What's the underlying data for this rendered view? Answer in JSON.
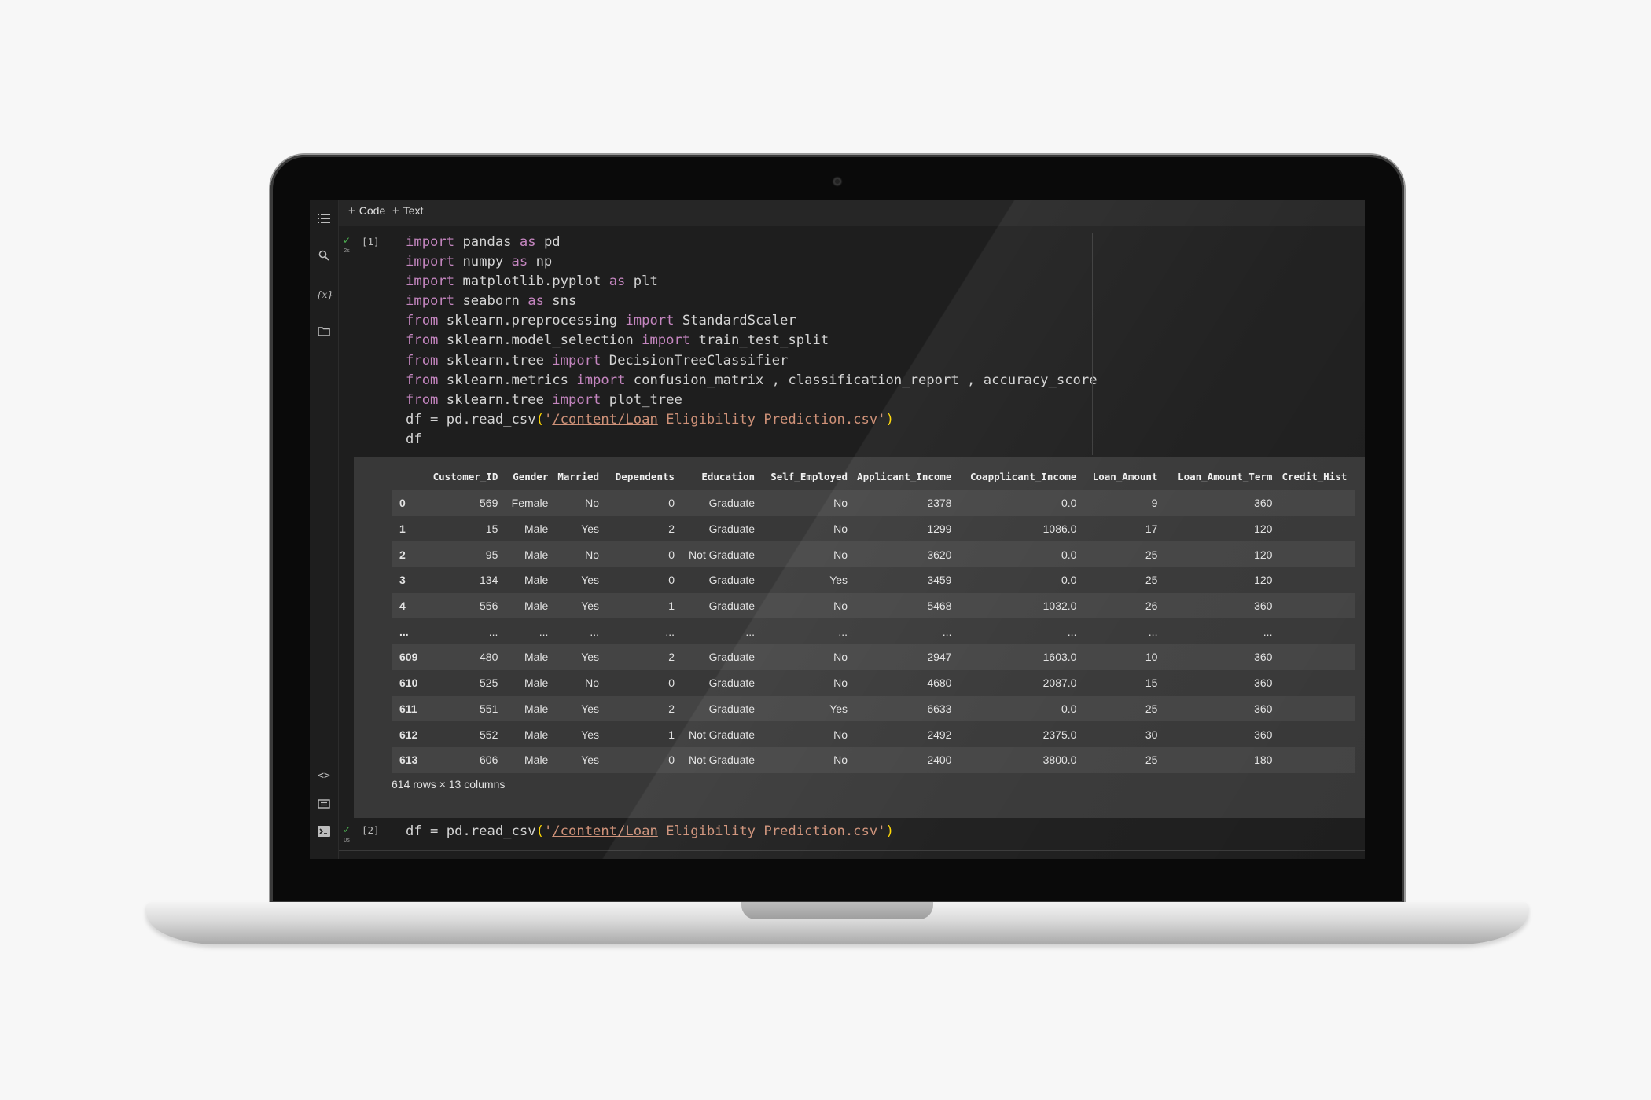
{
  "toolbar": {
    "add_code_label": "Code",
    "add_text_label": "Text"
  },
  "cell1": {
    "exec_count": "[1]",
    "run_time": "2s",
    "code_lines": [
      [
        {
          "t": "import",
          "c": "kw"
        },
        {
          "t": " pandas "
        },
        {
          "t": "as",
          "c": "kw"
        },
        {
          "t": " pd"
        }
      ],
      [
        {
          "t": "import",
          "c": "kw"
        },
        {
          "t": " numpy "
        },
        {
          "t": "as",
          "c": "kw"
        },
        {
          "t": " np"
        }
      ],
      [
        {
          "t": "import",
          "c": "kw"
        },
        {
          "t": " matplotlib.pyplot "
        },
        {
          "t": "as",
          "c": "kw"
        },
        {
          "t": " plt"
        }
      ],
      [
        {
          "t": "import",
          "c": "kw"
        },
        {
          "t": " seaborn "
        },
        {
          "t": "as",
          "c": "kw"
        },
        {
          "t": " sns"
        }
      ],
      [
        {
          "t": "from",
          "c": "kw"
        },
        {
          "t": " sklearn.preprocessing "
        },
        {
          "t": "import",
          "c": "kw"
        },
        {
          "t": " StandardScaler"
        }
      ],
      [
        {
          "t": "from",
          "c": "kw"
        },
        {
          "t": " sklearn.model_selection "
        },
        {
          "t": "import",
          "c": "kw"
        },
        {
          "t": " train_test_split"
        }
      ],
      [
        {
          "t": "from",
          "c": "kw"
        },
        {
          "t": " sklearn.tree "
        },
        {
          "t": "import",
          "c": "kw"
        },
        {
          "t": " DecisionTreeClassifier"
        }
      ],
      [
        {
          "t": "from",
          "c": "kw"
        },
        {
          "t": " sklearn.metrics "
        },
        {
          "t": "import",
          "c": "kw"
        },
        {
          "t": " confusion_matrix , classification_report , accuracy_score"
        }
      ],
      [
        {
          "t": "from",
          "c": "kw"
        },
        {
          "t": " sklearn.tree "
        },
        {
          "t": "import",
          "c": "kw"
        },
        {
          "t": " plot_tree"
        }
      ],
      [
        {
          "t": "df = pd.read_csv"
        },
        {
          "t": "(",
          "c": "paren"
        },
        {
          "t": "'",
          "c": "str"
        },
        {
          "t": "/content/Loan",
          "c": "str path"
        },
        {
          "t": " Eligibility Prediction.csv'",
          "c": "str"
        },
        {
          "t": ")",
          "c": "paren"
        }
      ],
      [
        {
          "t": "df"
        }
      ]
    ]
  },
  "dataframe": {
    "columns": [
      "",
      "Customer_ID",
      "Gender",
      "Married",
      "Dependents",
      "Education",
      "Self_Employed",
      "Applicant_Income",
      "Coapplicant_Income",
      "Loan_Amount",
      "Loan_Amount_Term",
      "Credit_Hist"
    ],
    "rows": [
      [
        "0",
        "569",
        "Female",
        "No",
        "0",
        "Graduate",
        "No",
        "2378",
        "0.0",
        "9",
        "360",
        ""
      ],
      [
        "1",
        "15",
        "Male",
        "Yes",
        "2",
        "Graduate",
        "No",
        "1299",
        "1086.0",
        "17",
        "120",
        ""
      ],
      [
        "2",
        "95",
        "Male",
        "No",
        "0",
        "Not Graduate",
        "No",
        "3620",
        "0.0",
        "25",
        "120",
        ""
      ],
      [
        "3",
        "134",
        "Male",
        "Yes",
        "0",
        "Graduate",
        "Yes",
        "3459",
        "0.0",
        "25",
        "120",
        ""
      ],
      [
        "4",
        "556",
        "Male",
        "Yes",
        "1",
        "Graduate",
        "No",
        "5468",
        "1032.0",
        "26",
        "360",
        ""
      ],
      [
        "...",
        "...",
        "...",
        "...",
        "...",
        "...",
        "...",
        "...",
        "...",
        "...",
        "...",
        ""
      ],
      [
        "609",
        "480",
        "Male",
        "Yes",
        "2",
        "Graduate",
        "No",
        "2947",
        "1603.0",
        "10",
        "360",
        ""
      ],
      [
        "610",
        "525",
        "Male",
        "No",
        "0",
        "Graduate",
        "No",
        "4680",
        "2087.0",
        "15",
        "360",
        ""
      ],
      [
        "611",
        "551",
        "Male",
        "Yes",
        "2",
        "Graduate",
        "Yes",
        "6633",
        "0.0",
        "25",
        "360",
        ""
      ],
      [
        "612",
        "552",
        "Male",
        "Yes",
        "1",
        "Not Graduate",
        "No",
        "2492",
        "2375.0",
        "30",
        "360",
        ""
      ],
      [
        "613",
        "606",
        "Male",
        "Yes",
        "0",
        "Not Graduate",
        "No",
        "2400",
        "3800.0",
        "25",
        "180",
        ""
      ]
    ],
    "shape_note": "614 rows × 13 columns"
  },
  "cell2": {
    "exec_count": "[2]",
    "run_time": "0s",
    "code_lines": [
      [
        {
          "t": "df = pd.read_csv"
        },
        {
          "t": "(",
          "c": "paren"
        },
        {
          "t": "'",
          "c": "str"
        },
        {
          "t": "/content/Loan",
          "c": "str path"
        },
        {
          "t": " Eligibility Prediction.csv'",
          "c": "str"
        },
        {
          "t": ")",
          "c": "paren"
        }
      ]
    ]
  },
  "colors": {
    "keyword": "#c586c0",
    "string": "#ce9178",
    "paren": "#ffd700",
    "success_check": "#4caf50"
  }
}
